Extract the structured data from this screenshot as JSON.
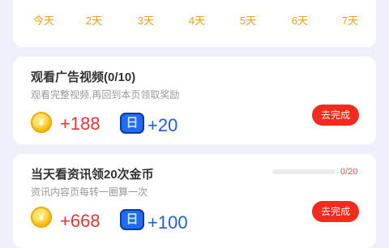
{
  "streak": {
    "days": [
      {
        "label": "今天",
        "icon": "gold-coin-icon"
      },
      {
        "label": "2天",
        "icon": "blue-reward-icon"
      },
      {
        "label": "3天",
        "icon": "gold-coin-icon"
      },
      {
        "label": "4天",
        "icon": "blue-reward-icon"
      },
      {
        "label": "5天",
        "icon": "gold-coin-icon"
      },
      {
        "label": "6天",
        "icon": "blue-reward-icon"
      },
      {
        "label": "7天",
        "icon": "blue-reward-icon"
      }
    ]
  },
  "tasks": [
    {
      "title": "观看广告视频(0/10)",
      "desc": "观看完整视频,再回到本页领取奖励",
      "coin_reward": "+188",
      "bucket_reward": "+20",
      "button": "去完成"
    },
    {
      "title": "当天看资讯领20次金币",
      "desc": "资讯内容页每转一圈算一次",
      "coin_reward": "+668",
      "bucket_reward": "+100",
      "button": "去完成",
      "progress_text": "0/20",
      "progress_value": 0
    }
  ],
  "colors": {
    "accent_red": "#f42a1d",
    "coin_gold": "#f7b500",
    "bucket_blue": "#1f6bf2",
    "day_label": "#f5a000"
  }
}
